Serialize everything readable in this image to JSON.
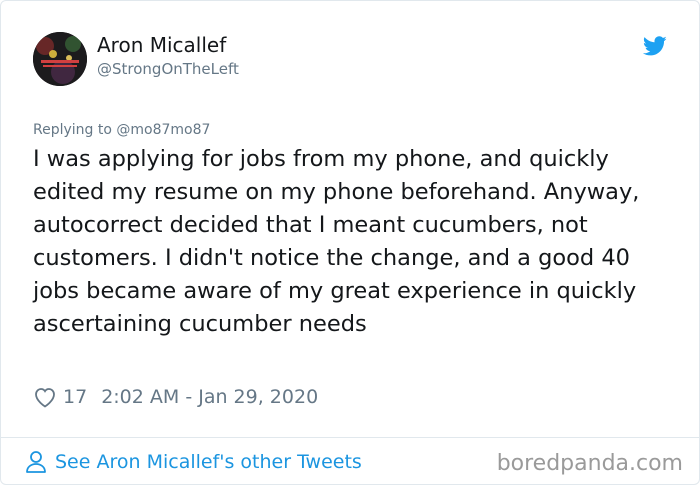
{
  "tweet": {
    "author_name": "Aron Micallef",
    "author_handle": "@StrongOnTheLeft",
    "reply_prefix": "Replying to @mo87mo87",
    "text": "I was applying for jobs from my phone, and quickly edited my resume on my phone beforehand. Anyway, autocorrect decided that I meant cucumbers, not customers. I didn't notice the change, and a good 40 jobs became aware of my great experience in quickly ascertaining cucumber needs",
    "likes": "17",
    "timestamp": "2:02 AM - Jan 29, 2020"
  },
  "footer": {
    "see_more_label": "See Aron Micallef's other Tweets",
    "watermark": "boredpanda.com"
  },
  "icons": {
    "brand": "twitter-bird-icon",
    "like": "heart-icon",
    "profile": "person-icon"
  },
  "colors": {
    "twitter_blue": "#1da1f2",
    "link_blue": "#1b95e0",
    "secondary_text": "#657786",
    "primary_text": "#14171a",
    "border": "#e1e8ed",
    "watermark": "#9a9a9a"
  }
}
